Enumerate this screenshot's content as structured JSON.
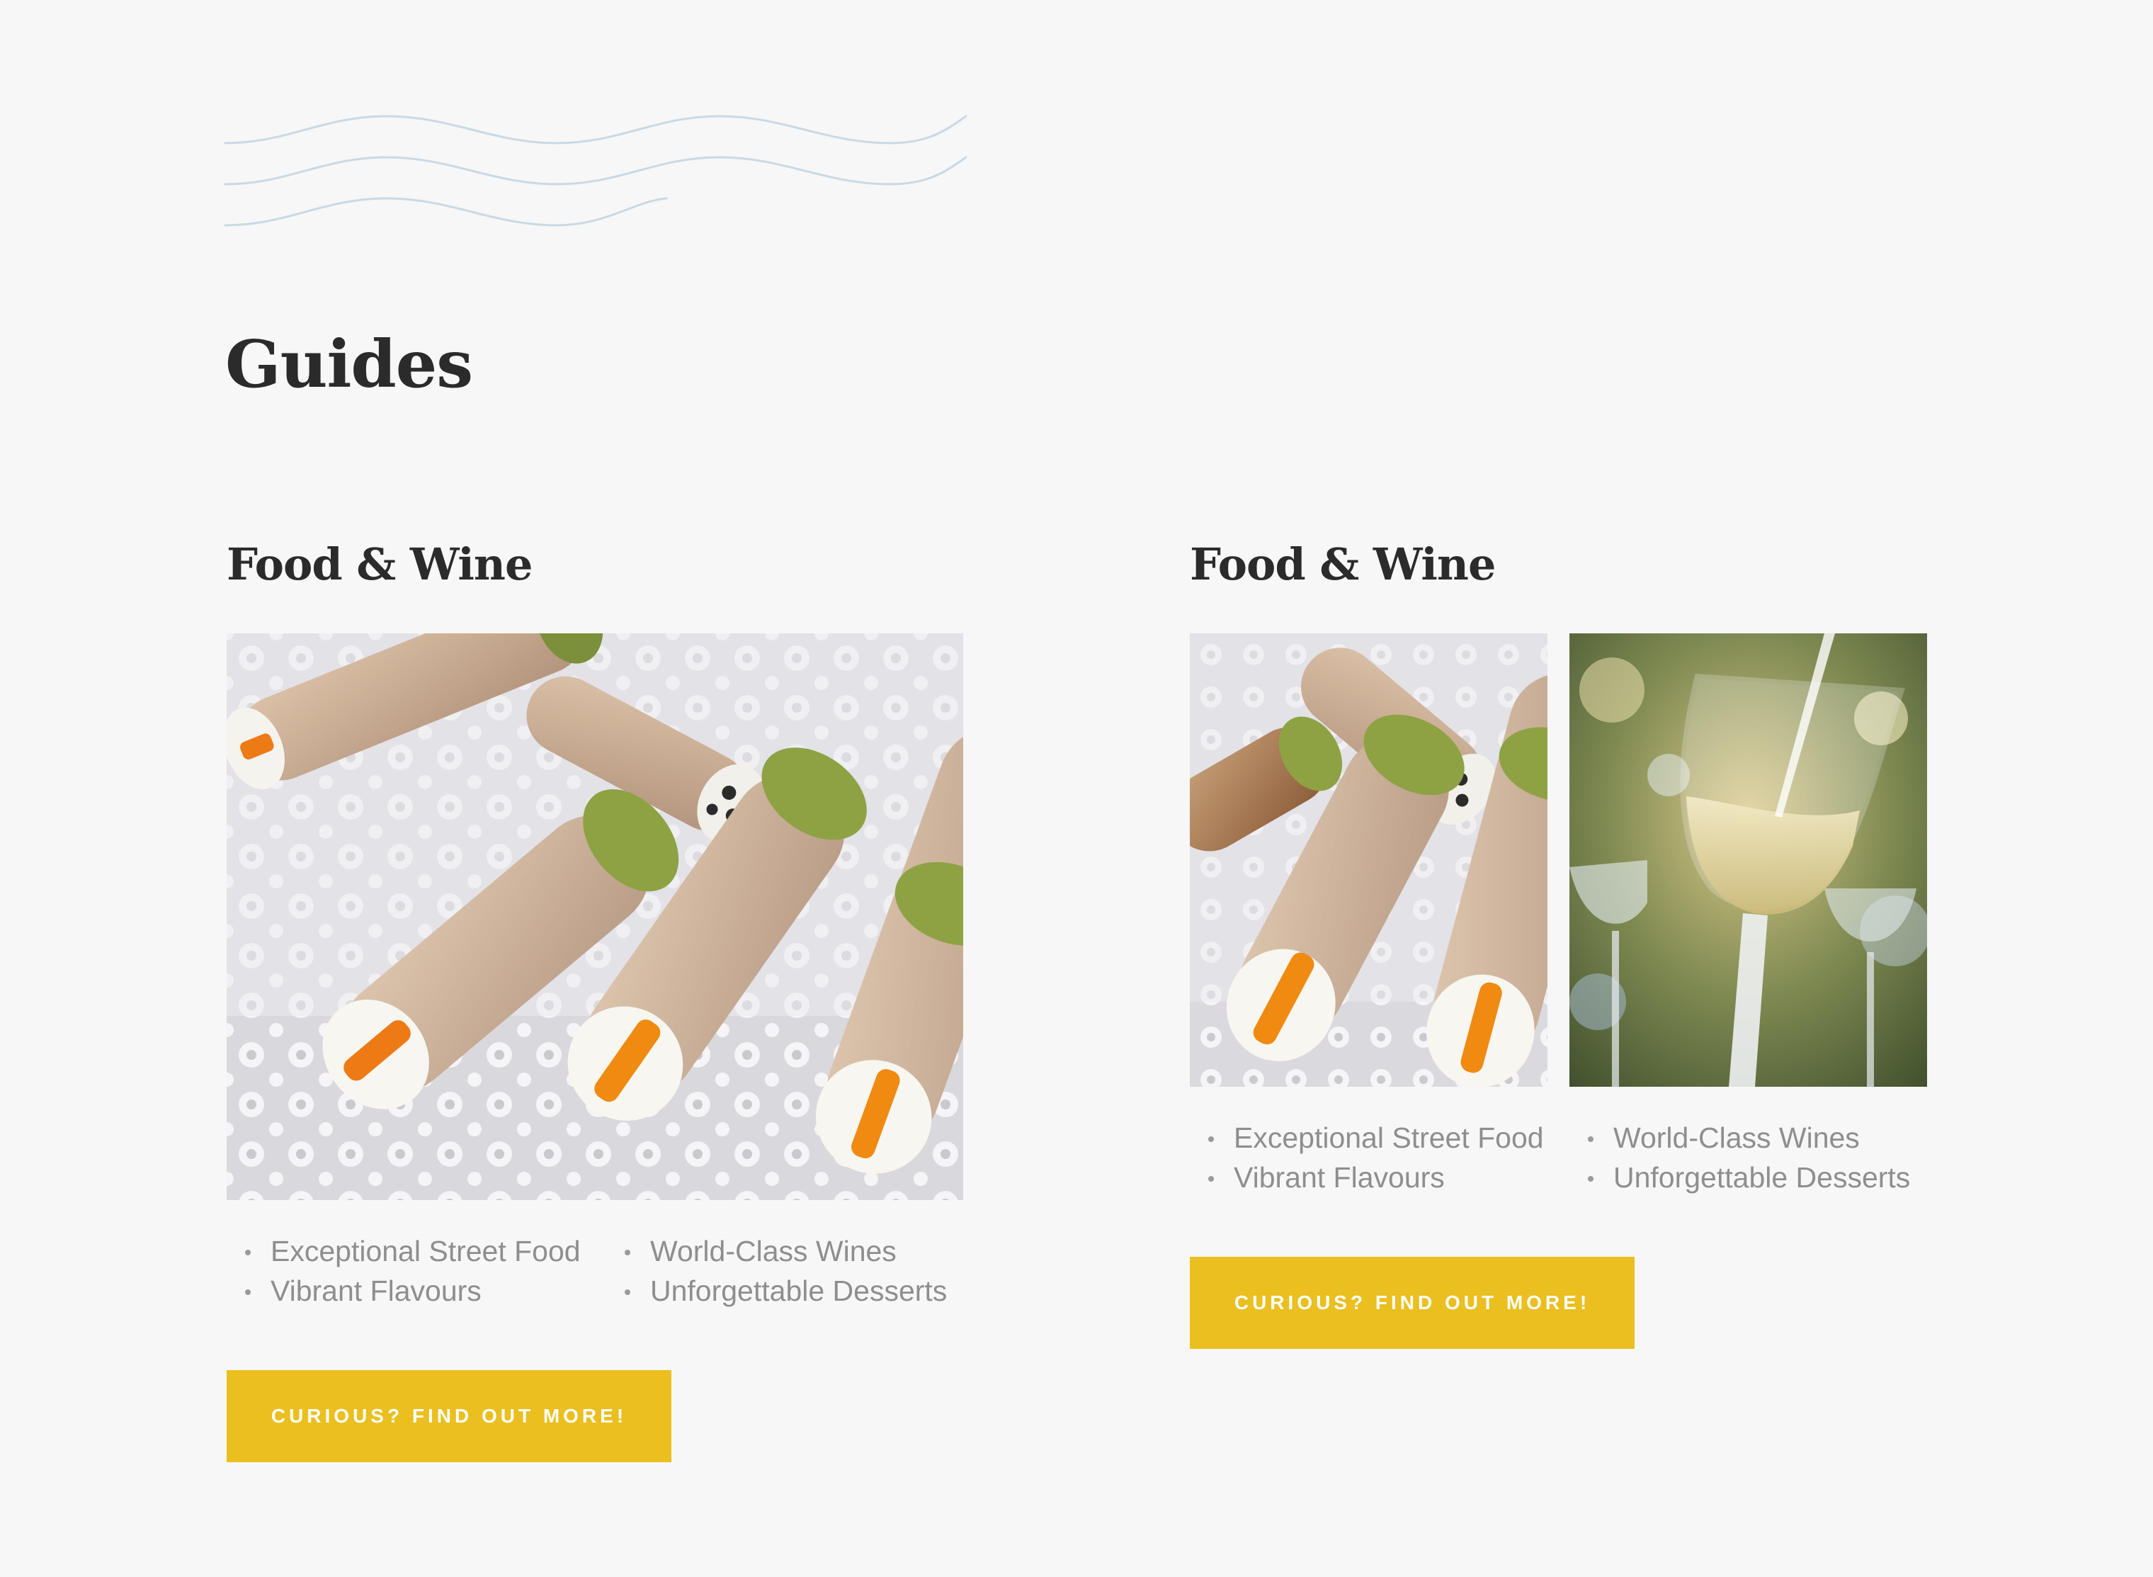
{
  "page": {
    "title": "Guides"
  },
  "colors": {
    "background": "#f7f7f7",
    "heading": "#2b2b2b",
    "body_text": "#8e8e8e",
    "accent": "#eabf1f",
    "wave": "#c8d9e6"
  },
  "decor": {
    "icon": "wave-lines-icon"
  },
  "cards": [
    {
      "title": "Food & Wine",
      "images": [
        "cannoli-photo"
      ],
      "features": [
        "Exceptional Street Food",
        "World-Class Wines",
        "Vibrant Flavours",
        "Unforgettable Desserts"
      ],
      "cta_label": "CURIOUS? FIND OUT MORE!"
    },
    {
      "title": "Food & Wine",
      "images": [
        "cannoli-photo",
        "wine-glass-photo"
      ],
      "features": [
        "Exceptional Street Food",
        "World-Class Wines",
        "Vibrant Flavours",
        "Unforgettable Desserts"
      ],
      "cta_label": "CURIOUS? FIND OUT MORE!"
    }
  ]
}
